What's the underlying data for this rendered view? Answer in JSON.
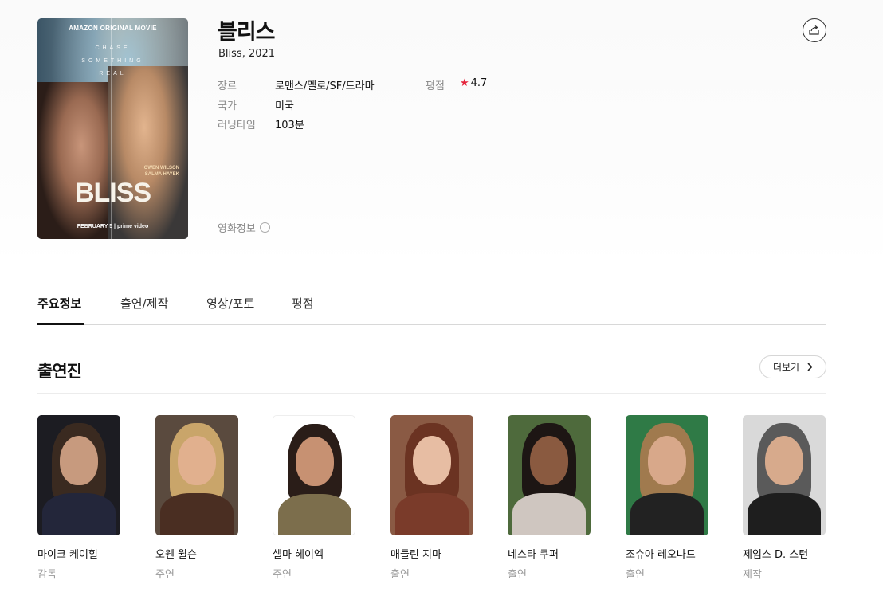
{
  "movie": {
    "title": "블리스",
    "subtitle": "Bliss, 2021",
    "poster": {
      "top_text": "AMAZON ORIGINAL MOVIE",
      "tagline": "CHASE\nSOMETHING\nREAL",
      "cast_text": "OWEN WILSON\nSALMA HAYEK",
      "poster_title": "BLISS",
      "footer": "FEBRUARY 5 | prime video"
    },
    "info": {
      "genre_label": "장르",
      "genre_value": "로맨스/멜로/SF/드라마",
      "country_label": "국가",
      "country_value": "미국",
      "runtime_label": "러닝타임",
      "runtime_value": "103분",
      "rating_label": "평점",
      "rating_value": "4.7"
    },
    "movie_info_link": "영화정보",
    "share_icon": "share-icon"
  },
  "tabs": [
    {
      "label": "주요정보"
    },
    {
      "label": "출연/제작"
    },
    {
      "label": "영상/포토"
    },
    {
      "label": "평점"
    }
  ],
  "cast_section": {
    "title": "출연진",
    "more_label": "더보기",
    "members": [
      {
        "name": "마이크 케이힐",
        "role": "감독"
      },
      {
        "name": "오웬 윌슨",
        "role": "주연"
      },
      {
        "name": "셀마 헤이엑",
        "role": "주연"
      },
      {
        "name": "매들린 지마",
        "role": "출연"
      },
      {
        "name": "네스타 쿠퍼",
        "role": "출연"
      },
      {
        "name": "조슈아 레오나드",
        "role": "출연"
      },
      {
        "name": "제임스 D. 스턴",
        "role": "제작"
      }
    ]
  },
  "colors": {
    "rating_star": "#e5243b",
    "label_gray": "#888888",
    "text_dark": "#111111"
  }
}
